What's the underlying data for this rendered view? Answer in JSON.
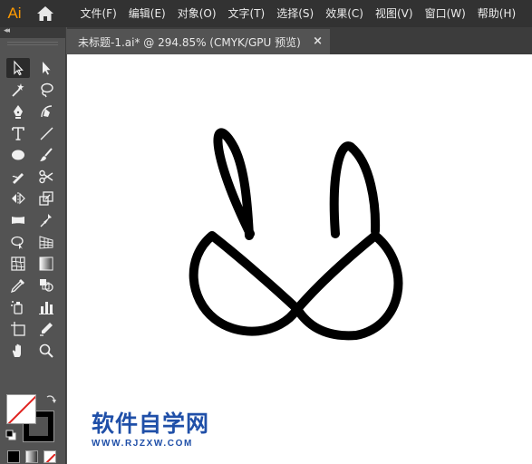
{
  "app": {
    "logo": "Ai"
  },
  "menu": [
    "文件(F)",
    "编辑(E)",
    "对象(O)",
    "文字(T)",
    "选择(S)",
    "效果(C)",
    "视图(V)",
    "窗口(W)",
    "帮助(H)"
  ],
  "toolbar": {
    "collapse_glyph": "◂◂"
  },
  "document": {
    "tab_title": "未标题-1.ai* @ 294.85% (CMYK/GPU 预览)",
    "close_glyph": "×"
  },
  "colors": {
    "menubar": "#323232",
    "panel": "#535353",
    "tabbar": "#3c3c3c",
    "canvas": "#ffffff",
    "logo": "#ff9a00",
    "watermark": "#1f4fa8"
  },
  "tools": [
    "selection-icon",
    "direct-selection-icon",
    "magic-wand-icon",
    "lasso-icon",
    "pen-icon",
    "curvature-icon",
    "type-icon",
    "line-segment-icon",
    "ellipse-icon",
    "paintbrush-icon",
    "shaper-icon",
    "scissors-icon",
    "reflect-icon",
    "scale-icon",
    "width-icon",
    "puppet-warp-icon",
    "shape-builder-icon",
    "perspective-grid-icon",
    "mesh-icon",
    "gradient-icon",
    "eyedropper-icon",
    "blend-icon",
    "symbol-sprayer-icon",
    "column-graph-icon",
    "artboard-icon",
    "slice-icon",
    "hand-icon",
    "zoom-icon"
  ],
  "watermark": {
    "main": "软件自学网",
    "url": "WWW.RJZXW.COM"
  }
}
